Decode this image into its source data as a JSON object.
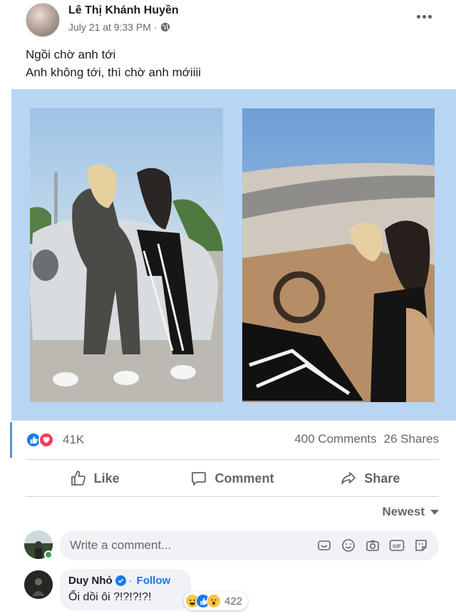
{
  "post": {
    "author": "Lê Thị Khánh Huyền",
    "timestamp": "July 21 at 9:33 PM · ",
    "privacy_icon": "globe-icon",
    "caption_line_1": "Ngồi chờ anh tới",
    "caption_line_2": "Anh không tới, thì chờ anh mớiiii",
    "photos": [
      {
        "name": "two-women-sitting-on-white-sports-car"
      },
      {
        "name": "two-women-inside-car-interior"
      }
    ]
  },
  "engagement": {
    "reaction_icons": [
      "like-icon",
      "love-icon"
    ],
    "reaction_count": "41K",
    "comments": "400 Comments",
    "shares": "26 Shares"
  },
  "actions": {
    "like": "Like",
    "comment": "Comment",
    "share": "Share"
  },
  "comments_section": {
    "sort_label": "Newest",
    "input_placeholder": "Write a comment...",
    "tool_icons": [
      "sticker-icon",
      "emoji-icon",
      "camera-icon",
      "gif-icon",
      "avatar-sticker-icon"
    ],
    "first_comment": {
      "author": "Duy Nhỏ",
      "follow_label": "Follow",
      "separator": "·",
      "text": "Ối dồi ôi ?!?!?!?!",
      "reaction_icons": [
        "haha-icon",
        "like-icon",
        "wow-icon"
      ],
      "reaction_count": "422"
    }
  },
  "colors": {
    "accent_blue": "#1877f2",
    "love_red": "#f33e58",
    "photo_background": "#b8d6f4",
    "secondary_text": "#65676b"
  }
}
